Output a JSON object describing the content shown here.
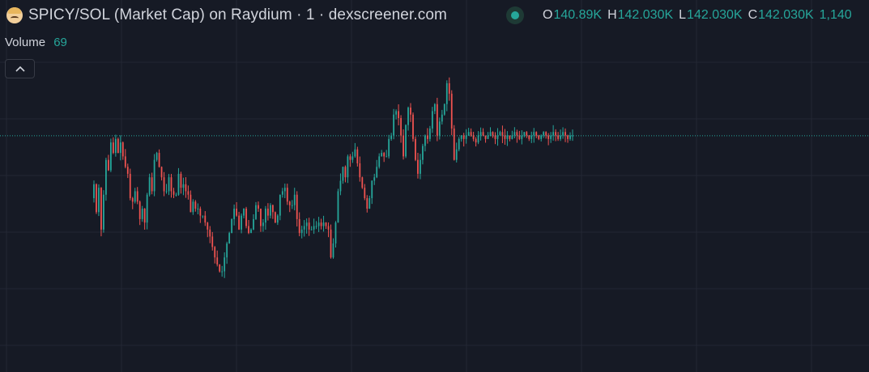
{
  "header": {
    "title": "SPICY/SOL (Market Cap) on Raydium · 1 · dexscreener.com",
    "avatar_icon": "token-avatar-icon",
    "status_color": "#26a69a"
  },
  "ohlc": {
    "open_label": "O",
    "open_value": "140.89K",
    "high_label": "H",
    "high_value": "142.030K",
    "low_label": "L",
    "low_value": "142.030K",
    "close_label": "C",
    "close_value": "142.030K",
    "extra_value": "1,140"
  },
  "volume": {
    "label": "Volume",
    "value": "69"
  },
  "colors": {
    "background": "#161a25",
    "grid": "#232733",
    "up": "#26a69a",
    "down": "#ef5350",
    "last_price_line": "#26a69a"
  },
  "chart_data": {
    "type": "line",
    "title": "SPICY/SOL (Market Cap) on Raydium · 1 · dexscreener.com",
    "xlabel": "",
    "ylabel": "",
    "grid": true,
    "last_value": 142.03,
    "ylim": [
      95,
      160
    ],
    "series": [
      {
        "name": "",
        "x": [
          0,
          1,
          2,
          3,
          4,
          5,
          6,
          7,
          8,
          9,
          10,
          11,
          12,
          13,
          14,
          15,
          16,
          17,
          18,
          19,
          20,
          21,
          22,
          23,
          24,
          25,
          26,
          27,
          28,
          29,
          30,
          31,
          32,
          33,
          34,
          35,
          36,
          37,
          38,
          39,
          40,
          41,
          42,
          43,
          44,
          45,
          46,
          47,
          48,
          49,
          50,
          51,
          52,
          53,
          54,
          55,
          56,
          57,
          58,
          59,
          60,
          61,
          62,
          63,
          64,
          65,
          66,
          67,
          68,
          69,
          70,
          71,
          72,
          73,
          74,
          75,
          76,
          77,
          78,
          79,
          80,
          81,
          82,
          83,
          84,
          85,
          86,
          87,
          88,
          89,
          90,
          91,
          92,
          93,
          94,
          95,
          96,
          97,
          98,
          99,
          100,
          101,
          102,
          103,
          104,
          105,
          106,
          107,
          108,
          109,
          110,
          111,
          112,
          113,
          114,
          115,
          116,
          117,
          118,
          119,
          120,
          121,
          122,
          123,
          124,
          125,
          126,
          127,
          128,
          129,
          130,
          131,
          132,
          133,
          134,
          135,
          136,
          137,
          138,
          139,
          140,
          141,
          142,
          143,
          144,
          145,
          146,
          147,
          148,
          149,
          150,
          151,
          152,
          153,
          154,
          155,
          156,
          157,
          158,
          159,
          160,
          161,
          162,
          163,
          164,
          165,
          166,
          167,
          168,
          169,
          170,
          171,
          172,
          173,
          174,
          175,
          176,
          177,
          178,
          179,
          180,
          181,
          182,
          183,
          184,
          185,
          186,
          187,
          188,
          189,
          190,
          191,
          192,
          193,
          194,
          195,
          196,
          197,
          198,
          199
        ],
        "values": [
          124,
          128,
          120,
          127,
          115,
          125,
          135,
          132,
          140,
          137,
          141,
          137,
          140,
          136,
          133,
          131,
          124,
          123,
          126,
          123,
          118,
          121,
          117,
          125,
          130,
          126,
          135,
          137,
          133,
          130,
          126,
          126,
          130,
          126,
          125,
          125,
          131,
          127,
          128,
          126,
          125,
          120,
          123,
          121,
          121,
          119,
          119,
          117,
          115,
          113,
          110,
          107,
          105,
          103,
          103,
          107,
          111,
          114,
          118,
          121,
          119,
          115,
          119,
          121,
          116,
          114,
          115,
          118,
          122,
          121,
          116,
          117,
          121,
          119,
          122,
          120,
          117,
          119,
          125,
          126,
          127,
          123,
          122,
          122,
          125,
          118,
          114,
          115,
          116,
          117,
          115,
          115,
          116,
          116,
          117,
          116,
          117,
          116,
          115,
          107,
          111,
          117,
          126,
          129,
          133,
          130,
          136,
          135,
          136,
          138,
          134,
          130,
          127,
          124,
          121,
          124,
          129,
          130,
          133,
          136,
          137,
          136,
          136,
          141,
          142,
          148,
          149,
          147,
          142,
          136,
          145,
          150,
          148,
          141,
          135,
          131,
          135,
          139,
          142,
          141,
          144,
          149,
          151,
          142,
          146,
          148,
          151,
          157,
          154,
          144,
          135,
          138,
          141,
          142,
          141,
          142,
          143,
          142,
          141,
          140,
          142,
          143,
          142,
          141,
          142,
          143,
          142,
          141,
          142,
          143,
          142,
          141,
          142,
          141,
          142,
          143,
          142,
          141,
          142,
          143,
          142,
          141,
          142,
          143,
          142,
          141,
          142,
          143,
          142,
          141,
          142,
          143,
          142,
          141,
          142,
          143,
          142,
          141,
          142,
          142
        ]
      }
    ]
  }
}
